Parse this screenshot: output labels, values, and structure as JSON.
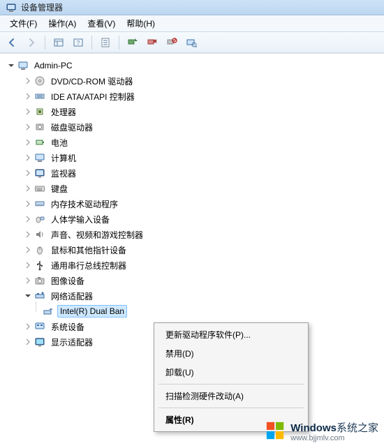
{
  "title": "设备管理器",
  "menubar": {
    "file": "文件(F)",
    "action": "操作(A)",
    "view": "查看(V)",
    "help": "帮助(H)"
  },
  "tree": {
    "root": "Admin-PC",
    "items": [
      {
        "label": "DVD/CD-ROM 驱动器"
      },
      {
        "label": "IDE ATA/ATAPI 控制器"
      },
      {
        "label": "处理器"
      },
      {
        "label": "磁盘驱动器"
      },
      {
        "label": "电池"
      },
      {
        "label": "计算机"
      },
      {
        "label": "监视器"
      },
      {
        "label": "键盘"
      },
      {
        "label": "内存技术驱动程序"
      },
      {
        "label": "人体学输入设备"
      },
      {
        "label": "声音、视频和游戏控制器"
      },
      {
        "label": "鼠标和其他指针设备"
      },
      {
        "label": "通用串行总线控制器"
      },
      {
        "label": "图像设备"
      },
      {
        "label": "网络适配器",
        "expanded": true
      },
      {
        "label": "系统设备"
      },
      {
        "label": "显示适配器"
      }
    ],
    "network_child": "Intel(R) Dual Ban"
  },
  "context_menu": {
    "update": "更新驱动程序软件(P)...",
    "disable": "禁用(D)",
    "uninstall": "卸载(U)",
    "scan": "扫描检测硬件改动(A)",
    "properties": "属性(R)"
  },
  "watermark": {
    "brand": "Windows",
    "brand_suffix": "系统之家",
    "url": "www.bjjmlv.com"
  }
}
